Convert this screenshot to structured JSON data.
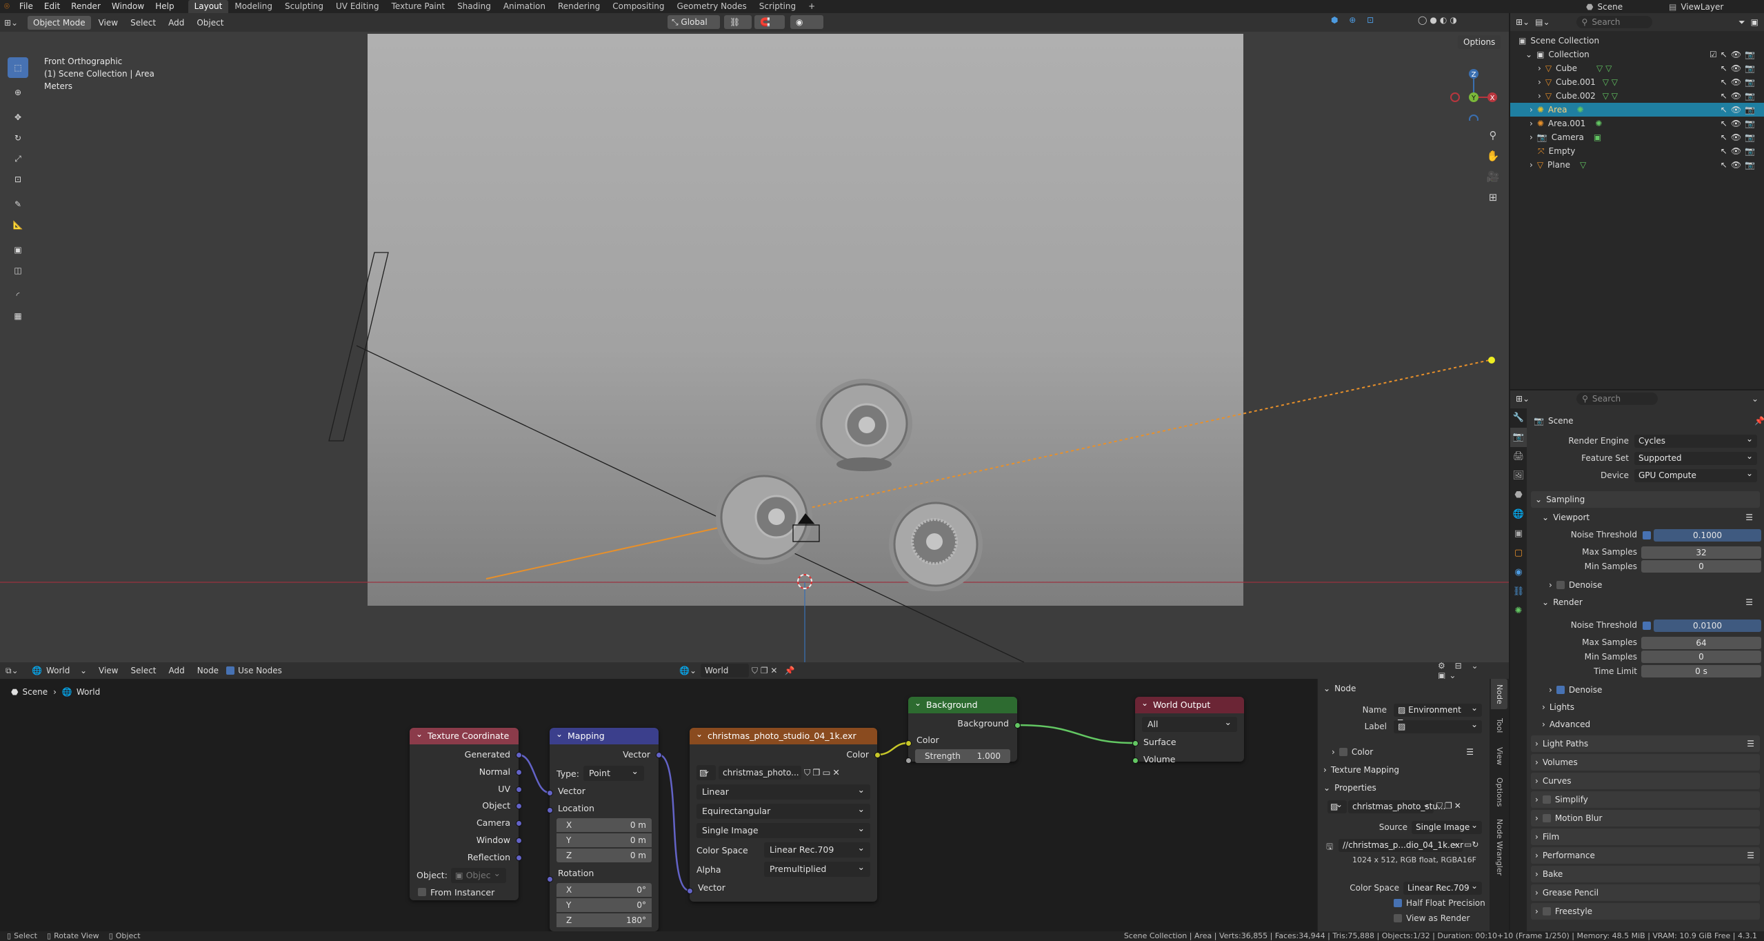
{
  "topbar": {
    "menus": [
      "File",
      "Edit",
      "Render",
      "Window",
      "Help"
    ],
    "workspaces": [
      "Layout",
      "Modeling",
      "Sculpting",
      "UV Editing",
      "Texture Paint",
      "Shading",
      "Animation",
      "Rendering",
      "Compositing",
      "Geometry Nodes",
      "Scripting"
    ],
    "active_workspace": "Layout",
    "plus": "+",
    "scene": "Scene",
    "view_layer": "ViewLayer"
  },
  "viewport": {
    "mode": "Object Mode",
    "menus": [
      "View",
      "Select",
      "Add",
      "Object"
    ],
    "orientation": "Global",
    "options": "Options",
    "overlay_lines": [
      "Front Orthographic",
      "(1) Scene Collection | Area",
      "Meters"
    ],
    "gizmo": {
      "z": "Z",
      "y": "Y",
      "x": "X"
    }
  },
  "node_editor": {
    "type": "World",
    "menus": [
      "View",
      "Select",
      "Add",
      "Node"
    ],
    "use_nodes": "Use Nodes",
    "world_name": "World",
    "breadcrumb": [
      "Scene",
      "World"
    ],
    "nodes": {
      "texcoord": {
        "title": "Texture Coordinate",
        "color": "#8b3b4a",
        "outputs": [
          "Generated",
          "Normal",
          "UV",
          "Object",
          "Camera",
          "Window",
          "Reflection"
        ],
        "object_label": "Object:",
        "object_placeholder": "Objec",
        "from_instancer": "From Instancer"
      },
      "mapping": {
        "title": "Mapping",
        "color": "#3b3f8c",
        "output": "Vector",
        "type_label": "Type:",
        "type_value": "Point",
        "inputs": [
          "Vector",
          "Location"
        ],
        "loc": [
          {
            "a": "X",
            "v": "0 m"
          },
          {
            "a": "Y",
            "v": "0 m"
          },
          {
            "a": "Z",
            "v": "0 m"
          }
        ],
        "rotation": "Rotation",
        "rot": [
          {
            "a": "X",
            "v": "0°"
          },
          {
            "a": "Y",
            "v": "0°"
          },
          {
            "a": "Z",
            "v": "180°"
          }
        ]
      },
      "envtex": {
        "title": "christmas_photo_studio_04_1k.exr",
        "color": "#8a4b1f",
        "output": "Color",
        "image": "christmas_photo...",
        "interp": "Linear",
        "proj": "Equirectangular",
        "ext": "Single Image",
        "cs_label": "Color Space",
        "cs_value": "Linear Rec.709",
        "alpha_label": "Alpha",
        "alpha_value": "Premultiplied",
        "input": "Vector"
      },
      "background": {
        "title": "Background",
        "color": "#2d6b30",
        "output": "Background",
        "color_in": "Color",
        "strength_label": "Strength",
        "strength_value": "1.000"
      },
      "output": {
        "title": "World Output",
        "color": "#6b2535",
        "target": "All",
        "inputs": [
          "Surface",
          "Volume"
        ]
      }
    }
  },
  "node_sidebar": {
    "node_section": "Node",
    "name_label": "Name",
    "name_value": "Environment Tex...",
    "label_label": "Label",
    "color_section": "Color",
    "texture_mapping": "Texture Mapping",
    "properties": "Properties",
    "image_name": "christmas_photo_stu...",
    "source_label": "Source",
    "source_value": "Single Image",
    "filepath": "//christmas_p...dio_04_1k.exr",
    "info": "1024 x 512,  RGB float, RGBA16F",
    "cs_label": "Color Space",
    "cs_value": "Linear Rec.709",
    "half_float": "Half Float Precision",
    "view_as_render": "View as Render",
    "tabs": [
      "Node",
      "Tool",
      "View",
      "Options",
      "Node Wrangler"
    ]
  },
  "outliner": {
    "search_placeholder": "Search",
    "root": "Scene Collection",
    "collection": "Collection",
    "items": [
      {
        "name": "Cube",
        "kind": "mesh",
        "indent": 1
      },
      {
        "name": "Cube.001",
        "kind": "mesh",
        "indent": 1
      },
      {
        "name": "Cube.002",
        "kind": "mesh",
        "indent": 1
      },
      {
        "name": "Area",
        "kind": "light",
        "indent": 0,
        "selected": true
      },
      {
        "name": "Area.001",
        "kind": "light",
        "indent": 0
      },
      {
        "name": "Camera",
        "kind": "camera",
        "indent": 0
      },
      {
        "name": "Empty",
        "kind": "empty",
        "indent": 0
      },
      {
        "name": "Plane",
        "kind": "mesh",
        "indent": 0
      }
    ]
  },
  "properties": {
    "search_placeholder": "Search",
    "context": "Scene",
    "render_engine_label": "Render Engine",
    "render_engine": "Cycles",
    "feature_set_label": "Feature Set",
    "feature_set": "Supported",
    "device_label": "Device",
    "device": "GPU Compute",
    "sampling": "Sampling",
    "viewport": "Viewport",
    "vp_noise_label": "Noise Threshold",
    "vp_noise": "0.1000",
    "vp_max_label": "Max Samples",
    "vp_max": "32",
    "vp_min_label": "Min Samples",
    "vp_min": "0",
    "vp_denoise": "Denoise",
    "render": "Render",
    "r_noise_label": "Noise Threshold",
    "r_noise": "0.0100",
    "r_max_label": "Max Samples",
    "r_max": "64",
    "r_min_label": "Min Samples",
    "r_min": "0",
    "time_limit_label": "Time Limit",
    "time_limit": "0 s",
    "r_denoise": "Denoise",
    "lights": "Lights",
    "advanced": "Advanced",
    "panels": [
      "Light Paths",
      "Volumes",
      "Curves",
      "Simplify",
      "Motion Blur",
      "Film",
      "Performance",
      "Bake",
      "Grease Pencil",
      "Freestyle"
    ]
  },
  "status": {
    "left": [
      "Select",
      "Rotate View",
      "Object"
    ],
    "right": "Scene Collection | Area | Verts:36,855 | Faces:34,944 | Tris:75,888 | Objects:1/32 | Duration: 00:10+10 (Frame 1/250) | Memory: 48.5 MiB | VRAM: 10.9 GiB Free | 4.3.1"
  },
  "colors": {
    "accent": "#4772b3",
    "selection": "#1f7fa1",
    "socket_vector": "#6363c7",
    "socket_color": "#c7c729",
    "socket_shader": "#63c763",
    "socket_float": "#a1a1a1"
  }
}
